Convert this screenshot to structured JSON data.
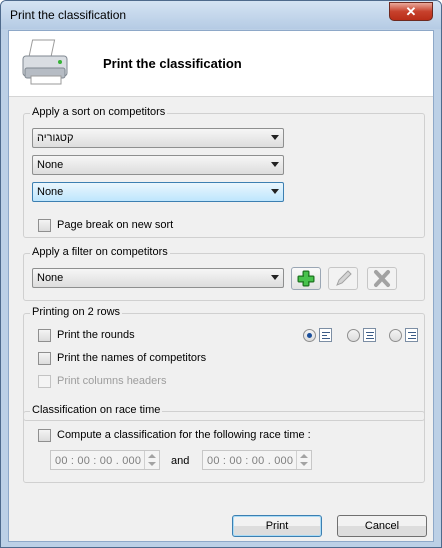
{
  "window": {
    "title": "Print the classification",
    "close_glyph": "✕"
  },
  "header": {
    "title": "Print the classification",
    "icon": "printer-icon"
  },
  "sort": {
    "group_title": "Apply a sort on competitors",
    "combo1": "קטגוריה",
    "combo2": "None",
    "combo3": "None",
    "page_break_label": "Page break on new sort",
    "page_break_checked": false
  },
  "filter": {
    "group_title": "Apply a filter on competitors",
    "combo": "None",
    "buttons": [
      "add-icon",
      "edit-icon",
      "delete-icon"
    ]
  },
  "two_rows": {
    "group_title": "Printing on 2 rows",
    "print_rounds_label": "Print the rounds",
    "print_names_label": "Print the names of competitors",
    "print_headers_label": "Print columns headers",
    "alignment_options": [
      "align-left-icon",
      "align-center-icon",
      "align-right-icon"
    ],
    "selected_alignment": "left"
  },
  "race_time": {
    "group_title": "Classification on race time",
    "compute_label": "Compute a classification for the following race time :",
    "time_from": "00 : 00 : 00 . 000",
    "and_label": "and",
    "time_to": "00 : 00 : 00 . 000"
  },
  "footer": {
    "print_label": "Print",
    "cancel_label": "Cancel"
  },
  "colors": {
    "titlebar": "#c9dbef",
    "close": "#c7412c",
    "add_green": "#2fa233"
  }
}
